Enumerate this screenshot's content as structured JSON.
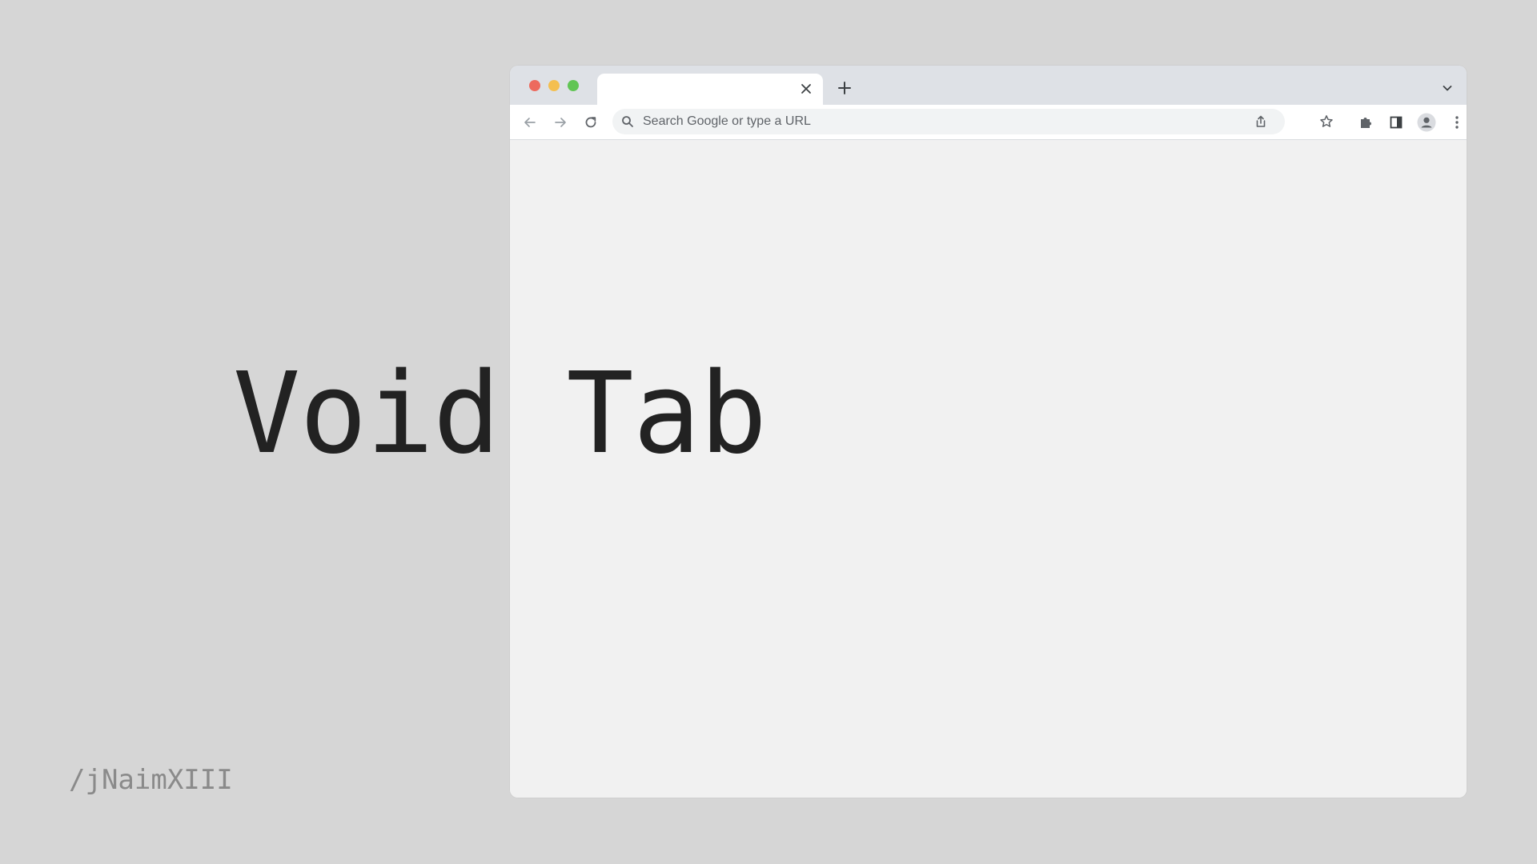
{
  "hero": {
    "title": "Void Tab",
    "handle": "/jNaimXIII"
  },
  "browser": {
    "tab": {
      "title": "",
      "close_icon": "close-icon"
    },
    "new_tab_icon": "plus-icon",
    "tab_search_icon": "chevron-down-icon",
    "toolbar": {
      "back_icon": "arrow-left-icon",
      "forward_icon": "arrow-right-icon",
      "reload_icon": "reload-icon",
      "omnibox": {
        "search_icon": "search-icon",
        "placeholder": "Search Google or type a URL",
        "value": "",
        "share_icon": "share-icon",
        "bookmark_icon": "star-icon"
      },
      "extensions_icon": "puzzle-icon",
      "side_panel_icon": "side-panel-icon",
      "profile_icon": "profile-icon",
      "menu_icon": "kebab-menu-icon"
    }
  },
  "colors": {
    "background": "#d6d6d6",
    "tabstrip": "#dee1e6",
    "viewport": "#f1f1f1",
    "traffic_red": "#ed6a5e",
    "traffic_yellow": "#f4bf4f",
    "traffic_green": "#61c554",
    "title_text": "#222222",
    "handle_text": "#8a8a8a"
  }
}
